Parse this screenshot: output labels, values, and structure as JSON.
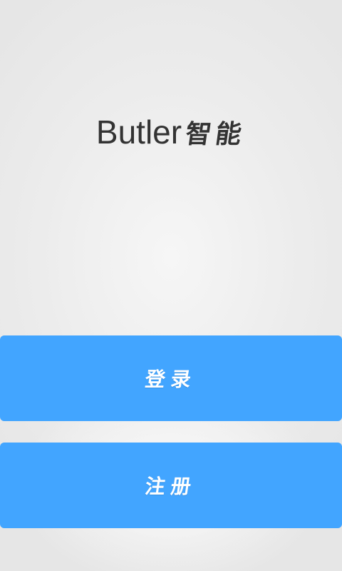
{
  "app": {
    "title_latin": "Butler",
    "title_cjk": "智能"
  },
  "buttons": {
    "login_label": "登录",
    "register_label": "注册"
  },
  "colors": {
    "button_background": "#42a5ff",
    "button_text": "#ffffff",
    "title_text": "#333333",
    "background": "#ececec"
  }
}
